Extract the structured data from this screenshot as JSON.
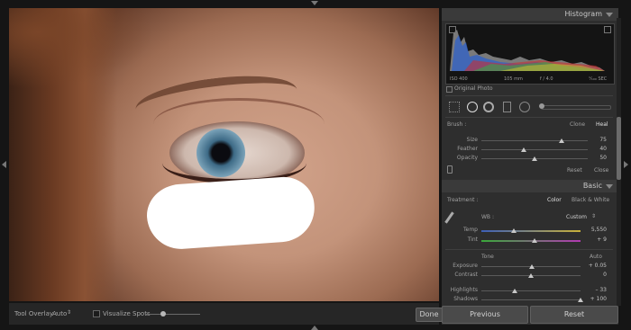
{
  "histogram": {
    "title": "Histogram",
    "iso": "ISO 400",
    "focal": "105 mm",
    "aperture": "f / 4.0",
    "shutter": "¹⁄₁₀₀ SEC",
    "original_photo": "Original Photo"
  },
  "brush": {
    "label": "Brush :",
    "clone": "Clone",
    "heal": "Heal",
    "rows": [
      {
        "label": "Size",
        "value": "75",
        "level": 0.75
      },
      {
        "label": "Feather",
        "value": "40",
        "level": 0.4
      },
      {
        "label": "Opacity",
        "value": "50",
        "level": 0.5
      }
    ],
    "reset": "Reset",
    "close": "Close"
  },
  "basic": {
    "title": "Basic",
    "treatment_label": "Treatment :",
    "color": "Color",
    "bw": "Black & White",
    "wb_label": "WB :",
    "wb_value": "Custom",
    "temp": {
      "label": "Temp",
      "value": "5,550",
      "level": 0.33
    },
    "tint": {
      "label": "Tint",
      "value": "+ 9",
      "level": 0.54
    },
    "tone_label": "Tone",
    "auto": "Auto",
    "exposure": {
      "label": "Exposure",
      "value": "+ 0.05",
      "level": 0.51
    },
    "contrast": {
      "label": "Contrast",
      "value": "0",
      "level": 0.5
    },
    "highlights": {
      "label": "Highlights",
      "value": "– 33",
      "level": 0.34
    },
    "shadows": {
      "label": "Shadows",
      "value": "+ 100",
      "level": 1.0
    }
  },
  "toolbar": {
    "tool_overlay_label": "Tool Overlay :",
    "tool_overlay_value": "Auto",
    "visualize_spots": "Visualize Spots",
    "done": "Done"
  },
  "buttons": {
    "previous": "Previous",
    "reset": "Reset"
  },
  "colors": {
    "panel": "#2e2e2e",
    "background": "#151515",
    "heal_spot": "#ffffff"
  }
}
